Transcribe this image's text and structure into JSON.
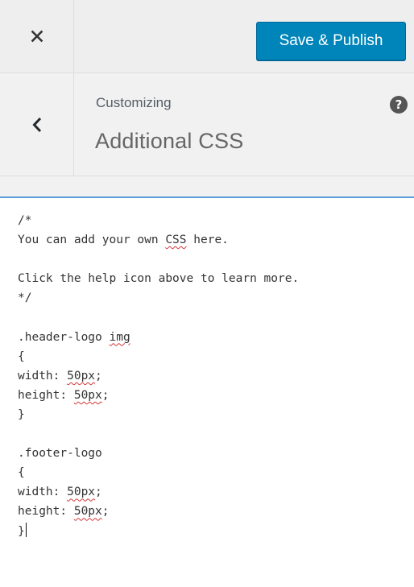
{
  "header": {
    "publish_label": "Save & Publish"
  },
  "section": {
    "breadcrumb": "Customizing",
    "title": "Additional CSS",
    "help_glyph": "?"
  },
  "icons": {
    "close": "close-icon",
    "back": "chevron-left-icon",
    "help": "help-icon"
  },
  "colors": {
    "top_bar_bg": "#eeeeee",
    "panel_bg": "#f1f1f1",
    "publish_button_bg": "#0085ba",
    "focus_line": "#5b9dd9",
    "spellcheck_underline": "#d63638"
  },
  "editor": {
    "lines": [
      [
        {
          "text": "/*"
        }
      ],
      [
        {
          "text": "You can add your own "
        },
        {
          "text": "CSS",
          "misspelled": true
        },
        {
          "text": " here."
        }
      ],
      [],
      [
        {
          "text": "Click the help icon above to learn more."
        }
      ],
      [
        {
          "text": "*/"
        }
      ],
      [],
      [
        {
          "text": ".header-logo "
        },
        {
          "text": "img",
          "misspelled": true
        }
      ],
      [
        {
          "text": "{"
        }
      ],
      [
        {
          "text": "width: "
        },
        {
          "text": "50px",
          "misspelled": true
        },
        {
          "text": ";"
        }
      ],
      [
        {
          "text": "height: "
        },
        {
          "text": "50px",
          "misspelled": true
        },
        {
          "text": ";"
        }
      ],
      [
        {
          "text": "}"
        }
      ],
      [],
      [
        {
          "text": ".footer-logo"
        }
      ],
      [
        {
          "text": "{"
        }
      ],
      [
        {
          "text": "width: "
        },
        {
          "text": "50px",
          "misspelled": true
        },
        {
          "text": ";"
        }
      ],
      [
        {
          "text": "height: "
        },
        {
          "text": "50px",
          "misspelled": true
        },
        {
          "text": ";"
        }
      ],
      [
        {
          "text": "}"
        }
      ]
    ]
  }
}
